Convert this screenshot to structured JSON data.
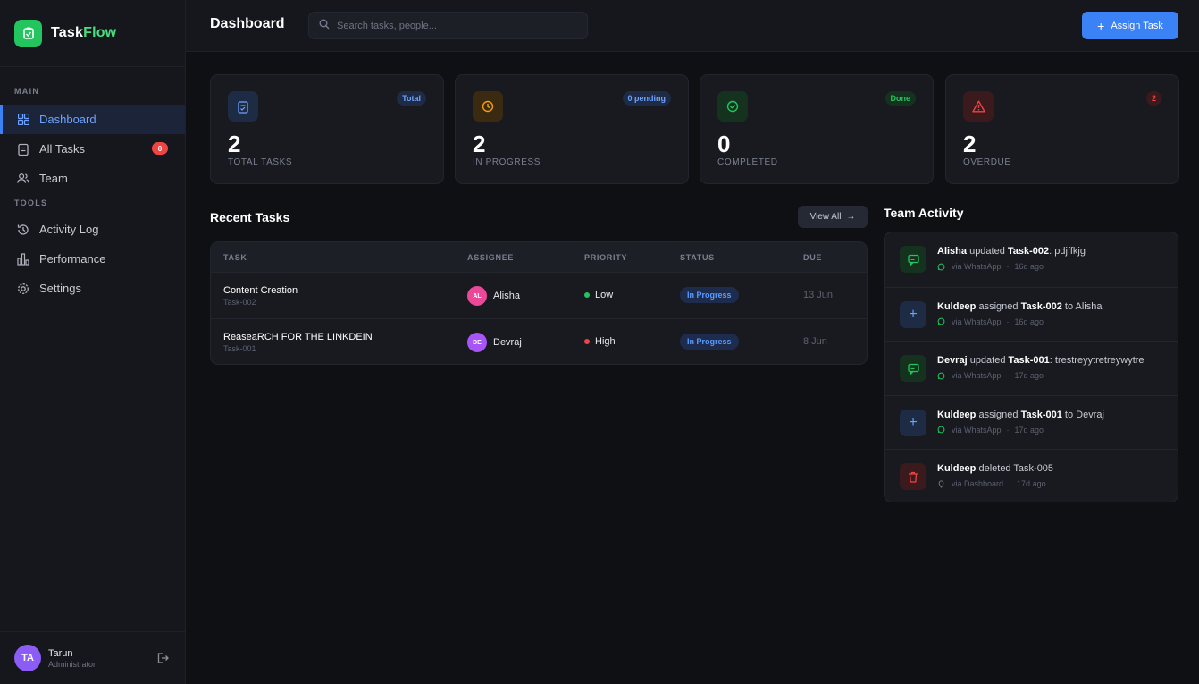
{
  "brand": {
    "name_part1": "Task",
    "name_part2": "Flow",
    "logo_icon": "clipboard-icon",
    "accent": "#22c55e"
  },
  "sidebar": {
    "main_label": "MAIN",
    "tools_label": "TOOLS",
    "main_items": [
      {
        "label": "Dashboard",
        "icon": "grid-icon",
        "active": true
      },
      {
        "label": "All Tasks",
        "icon": "clipboard-list-icon",
        "badge": "0"
      },
      {
        "label": "Team",
        "icon": "users-icon"
      }
    ],
    "tools_items": [
      {
        "label": "Activity Log",
        "icon": "history-icon"
      },
      {
        "label": "Performance",
        "icon": "bar-chart-icon"
      },
      {
        "label": "Settings",
        "icon": "gear-icon"
      }
    ],
    "user": {
      "initials": "TA",
      "name": "Tarun",
      "role": "Administrator"
    }
  },
  "header": {
    "title": "Dashboard",
    "search_placeholder": "Search tasks, people...",
    "assign_button": "Assign Task"
  },
  "stats": [
    {
      "value": "2",
      "label": "TOTAL TASKS",
      "badge": "Total",
      "icon": "clipboard-check-icon",
      "color": "#6ea3ff"
    },
    {
      "value": "2",
      "label": "IN PROGRESS",
      "badge": "0 pending",
      "icon": "clock-icon",
      "color": "#f59e0b"
    },
    {
      "value": "0",
      "label": "COMPLETED",
      "badge": "Done",
      "icon": "check-circle-icon",
      "color": "#22c55e"
    },
    {
      "value": "2",
      "label": "OVERDUE",
      "badge": "2",
      "icon": "warning-icon",
      "color": "#ef4444"
    }
  ],
  "recent_tasks": {
    "title": "Recent Tasks",
    "view_all": "View All",
    "columns": [
      "TASK",
      "ASSIGNEE",
      "PRIORITY",
      "STATUS",
      "DUE"
    ],
    "rows": [
      {
        "name": "Content Creation",
        "id": "Task-002",
        "assignee_initials": "AL",
        "assignee": "Alisha",
        "assignee_color": "#ec4899",
        "priority": "Low",
        "priority_color": "#22c55e",
        "status": "In Progress",
        "due": "13 Jun"
      },
      {
        "name": "ReaseaRCH FOR THE LINKDEIN",
        "id": "Task-001",
        "assignee_initials": "DE",
        "assignee": "Devraj",
        "assignee_color": "#a855f7",
        "priority": "High",
        "priority_color": "#ef4444",
        "status": "In Progress",
        "due": "8 Jun"
      }
    ]
  },
  "activity": {
    "title": "Team Activity",
    "items": [
      {
        "actor": "Alisha",
        "verb": " updated ",
        "target": "Task-002",
        "rest": ": pdjffkjg",
        "source": "via WhatsApp",
        "time": "16d ago",
        "icon": "message-icon"
      },
      {
        "actor": "Kuldeep",
        "verb": " assigned ",
        "target": "Task-002",
        "rest": " to Alisha",
        "source": "via WhatsApp",
        "time": "16d ago",
        "icon": "plus-icon"
      },
      {
        "actor": "Devraj",
        "verb": " updated ",
        "target": "Task-001",
        "rest": ": trestreyytretreywytre",
        "source": "via WhatsApp",
        "time": "17d ago",
        "icon": "message-icon"
      },
      {
        "actor": "Kuldeep",
        "verb": " assigned ",
        "target": "Task-001",
        "rest": " to Devraj",
        "source": "via WhatsApp",
        "time": "17d ago",
        "icon": "plus-icon"
      },
      {
        "actor": "Kuldeep",
        "verb": " deleted Task-005",
        "target": "",
        "rest": "",
        "source": "via Dashboard",
        "time": "17d ago",
        "icon": "trash-icon"
      }
    ]
  }
}
